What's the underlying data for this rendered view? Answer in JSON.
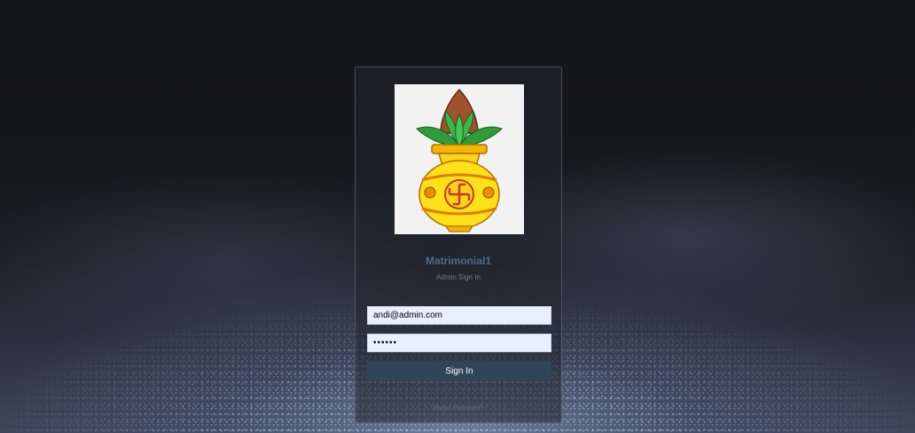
{
  "login": {
    "app_name": "Matrimonial1",
    "subtitle": "Admin Sign In",
    "email_value": "andi@admin.com",
    "password_value": "••••••",
    "signin_label": "Sign In",
    "forgot_label": "Forgot Password?"
  },
  "logo": {
    "icon": "kalash-icon"
  },
  "colors": {
    "button": "#2f4558",
    "title": "#4f6a86",
    "input_bg": "#e8f0fe"
  }
}
